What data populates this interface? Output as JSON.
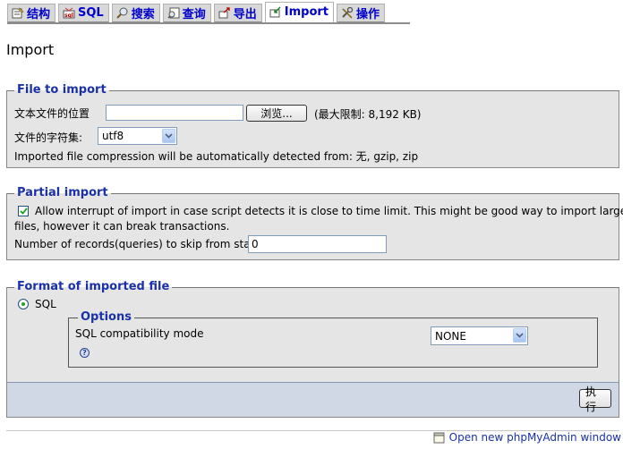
{
  "tabs": [
    {
      "label": "结构",
      "icon": "structure-icon",
      "active": false
    },
    {
      "label": "SQL",
      "icon": "sql-icon",
      "active": false
    },
    {
      "label": "搜索",
      "icon": "search-icon",
      "active": false
    },
    {
      "label": "查询",
      "icon": "query-icon",
      "active": false
    },
    {
      "label": "导出",
      "icon": "export-icon",
      "active": false
    },
    {
      "label": "Import",
      "icon": "import-icon",
      "active": true
    },
    {
      "label": "操作",
      "icon": "operations-icon",
      "active": false
    }
  ],
  "page_title": "Import",
  "file_section": {
    "legend": "File to import",
    "location_label": "文本文件的位置",
    "file_value": "",
    "browse_label": "浏览...",
    "max_limit": "(最大限制: 8,192 KB)",
    "charset_label": "文件的字符集:",
    "charset_value": "utf8",
    "compression_note": "Imported file compression will be automatically detected from: 无, gzip, zip"
  },
  "partial_section": {
    "legend": "Partial import",
    "allow_interrupt_checked": true,
    "allow_interrupt_line1": "Allow interrupt of import in case script detects it is close to time limit. This might be good way to import large",
    "allow_interrupt_line2": "files, however it can break transactions.",
    "skip_label": "Number of records(queries) to skip from start",
    "skip_value": "0"
  },
  "format_section": {
    "legend": "Format of imported file",
    "format_option": "SQL",
    "format_selected": true,
    "options_legend": "Options",
    "compat_label": "SQL compatibility mode",
    "compat_value": "NONE",
    "help_glyph": "?"
  },
  "submit_label": "执行",
  "new_window_link": "Open new phpMyAdmin window",
  "colors": {
    "tab_text": "#0000cc",
    "legend_text": "#1a31a8",
    "fieldset_bg": "#e5e5e5",
    "footer_bar_bg": "#d0d8e5"
  }
}
